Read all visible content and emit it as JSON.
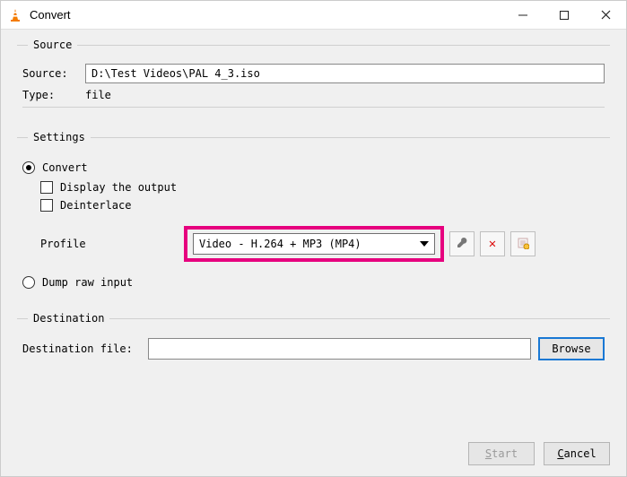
{
  "window": {
    "title": "Convert"
  },
  "source": {
    "legend": "Source",
    "source_label": "Source:",
    "source_value": "D:\\Test Videos\\PAL 4_3.iso",
    "type_label": "Type:",
    "type_value": "file"
  },
  "settings": {
    "legend": "Settings",
    "convert_label": "Convert",
    "display_output_label": "Display the output",
    "deinterlace_label": "Deinterlace",
    "profile_label": "Profile",
    "profile_value": "Video - H.264 + MP3 (MP4)",
    "dump_raw_label": "Dump raw input"
  },
  "destination": {
    "legend": "Destination",
    "file_label": "Destination file:",
    "file_value": "",
    "browse_label": "Browse"
  },
  "buttons": {
    "start_initial": "S",
    "start_rest": "tart",
    "cancel_initial": "C",
    "cancel_rest": "ancel"
  }
}
